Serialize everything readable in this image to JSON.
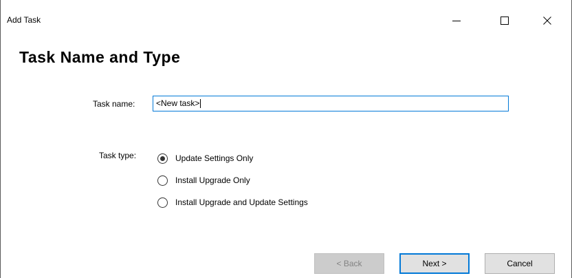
{
  "window": {
    "title": "Add Task"
  },
  "page": {
    "heading": "Task Name and Type"
  },
  "task_name": {
    "label": "Task name:",
    "value": "<New task>"
  },
  "task_type": {
    "label": "Task type:",
    "options": [
      {
        "label": "Update Settings Only",
        "selected": true
      },
      {
        "label": "Install Upgrade Only",
        "selected": false
      },
      {
        "label": "Install Upgrade and Update Settings",
        "selected": false
      }
    ]
  },
  "buttons": {
    "back": "< Back",
    "next": "Next >",
    "cancel": "Cancel"
  },
  "colors": {
    "accent": "#0078d7",
    "disabled_text": "#838383",
    "button_face": "#e1e1e1"
  },
  "icons": {
    "minimize": "minimize-icon",
    "maximize": "maximize-icon",
    "close": "close-icon"
  }
}
